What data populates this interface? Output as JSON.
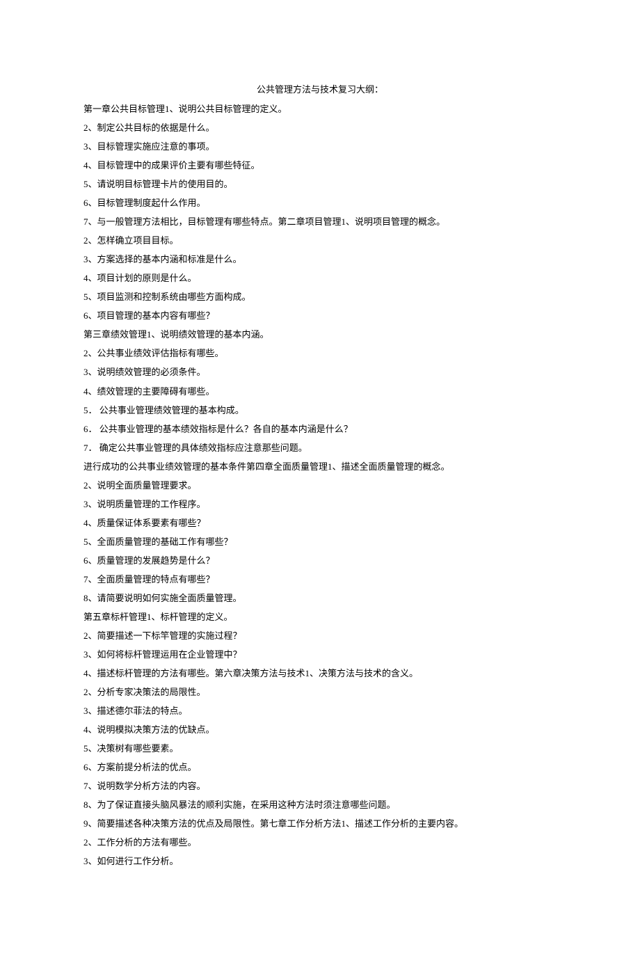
{
  "title": "公共管理方法与技术复习大纲：",
  "lines": [
    "第一章公共目标管理1、说明公共目标管理的定义。",
    "2、制定公共目标的依据是什么。",
    "3、目标管理实施应注意的事项。",
    "4、目标管理中的成果评价主要有哪些特征。",
    "5、请说明目标管理卡片的使用目的。",
    "6、目标管理制度起什么作用。",
    "7、与一般管理方法相比，目标管理有哪些特点。第二章项目管理1、说明项目管理的概念。",
    "2、怎样确立项目目标。",
    "3、方案选择的基本内涵和标准是什么。",
    "4、项目计划的原则是什么。",
    "5、项目监测和控制系统由哪些方面构成。",
    "6、项目管理的基本内容有哪些？",
    "第三章绩效管理1、说明绩效管理的基本内涵。",
    "2、公共事业绩效评估指标有哪些。",
    "3、说明绩效管理的必须条件。",
    "4、绩效管理的主要障碍有哪些。",
    "5． 公共事业管理绩效管理的基本构成。",
    "6． 公共事业管理的基本绩效指标是什么？各自的基本内涵是什么？",
    "7． 确定公共事业管理的具体绩效指标应注意那些问题。",
    "进行成功的公共事业绩效管理的基本条件第四章全面质量管理1、描述全面质量管理的概念。",
    "2、说明全面质量管理要求。",
    "3、说明质量管理的工作程序。",
    "4、质量保证体系要素有哪些？",
    "5、全面质量管理的基础工作有哪些？",
    "6、质量管理的发展趋势是什么？",
    "7、全面质量管理的特点有哪些？",
    "8、请简要说明如何实施全面质量管理。",
    "第五章标杆管理1、标杆管理的定义。",
    "2、简要描述一下标竿管理的实施过程？",
    "3、如何将标杆管理运用在企业管理中？",
    "4、描述标杆管理的方法有哪些。第六章决策方法与技术1、决策方法与技术的含义。",
    "2、分析专家决策法的局限性。",
    "3、描述德尔菲法的特点。",
    "4、说明模拟决策方法的优缺点。",
    "5、决策树有哪些要素。",
    "6、方案前提分析法的优点。",
    "7、说明数学分析方法的内容。",
    "8、为了保证直接头脑风暴法的顺利实施，在采用这种方法时须注意哪些问题。",
    "9、简要描述各种决策方法的优点及局限性。第七章工作分析方法1、描述工作分析的主要内容。",
    "2、工作分析的方法有哪些。",
    "3、如何进行工作分析。"
  ]
}
